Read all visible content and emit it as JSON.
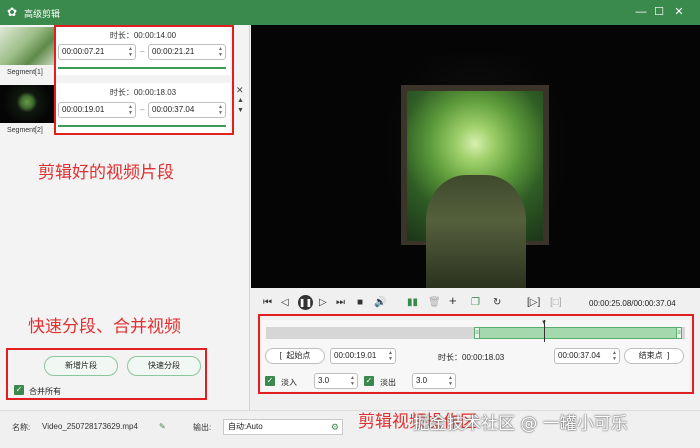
{
  "titlebar": {
    "title": "高级剪辑",
    "logo_icon": "rabbit-icon"
  },
  "segments": [
    {
      "label": "Segment[1]",
      "duration": "时长：00:00:14.00",
      "start": "00:00:07.21",
      "end": "00:00:21.21"
    },
    {
      "label": "Segment[2]",
      "duration": "时长：00:00:18.03",
      "start": "00:00:19.01",
      "end": "00:00:37.04"
    }
  ],
  "annotations": {
    "segments": "剪辑好的视频片段",
    "split_merge": "快速分段、合并视频",
    "editor": "剪辑视频操作区"
  },
  "left_actions": {
    "add_segment": "新增片段",
    "quick_split": "快速分段",
    "merge_all": "合并所有"
  },
  "player": {
    "timer": "00:00:25.08/00:00:37.04"
  },
  "timeline": {
    "start_btn": "起始点",
    "start_value": "00:00:19.01",
    "duration": "时长：00:00:18.03",
    "end_value": "00:00:37.04",
    "end_btn": "结束点",
    "fade_in_label": "淡入",
    "fade_in_value": "3.0",
    "fade_out_label": "淡出",
    "fade_out_value": "3.0"
  },
  "status": {
    "name_label": "名称:",
    "file_name": "Video_250728173629.mp4",
    "output_label": "输出:",
    "output_value": "自动:Auto"
  },
  "watermark": "掘金技术社区 @ 一罐小可乐",
  "colors": {
    "accent": "#3b8a4d",
    "annotation_red": "#e02020",
    "selection": "#a3d9ad"
  }
}
